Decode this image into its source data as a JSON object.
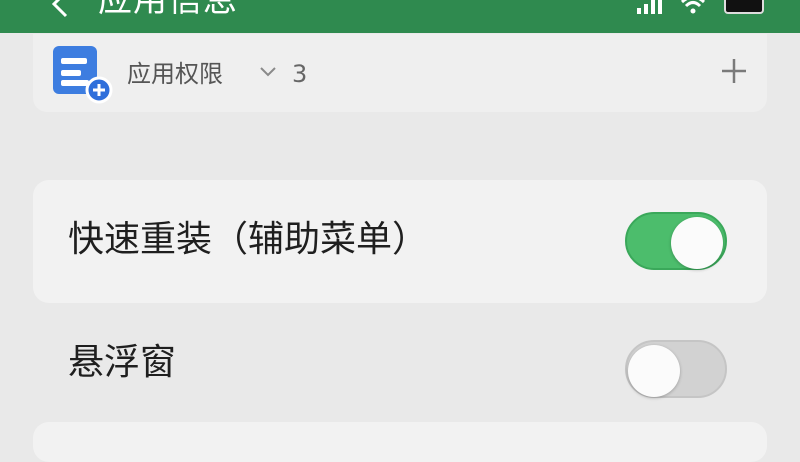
{
  "header": {
    "title": "应用信息",
    "back_icon": "back-arrow-icon",
    "status_icons": [
      "signal-icon",
      "wifi-icon",
      "battery-icon"
    ],
    "color": "#2f8a4f"
  },
  "permissions": {
    "label": "应用权限",
    "count": "3",
    "icon": "app-permissions-icon",
    "chevron": "chevron-down-icon",
    "add": "plus-icon"
  },
  "settings": [
    {
      "label": "快速重装（辅助菜单）",
      "enabled": true
    },
    {
      "label": "悬浮窗",
      "enabled": false
    }
  ],
  "colors": {
    "toggle_on": "#4cbd6c",
    "toggle_off": "#d2d2d2",
    "accent_blue": "#2f6fdb"
  }
}
